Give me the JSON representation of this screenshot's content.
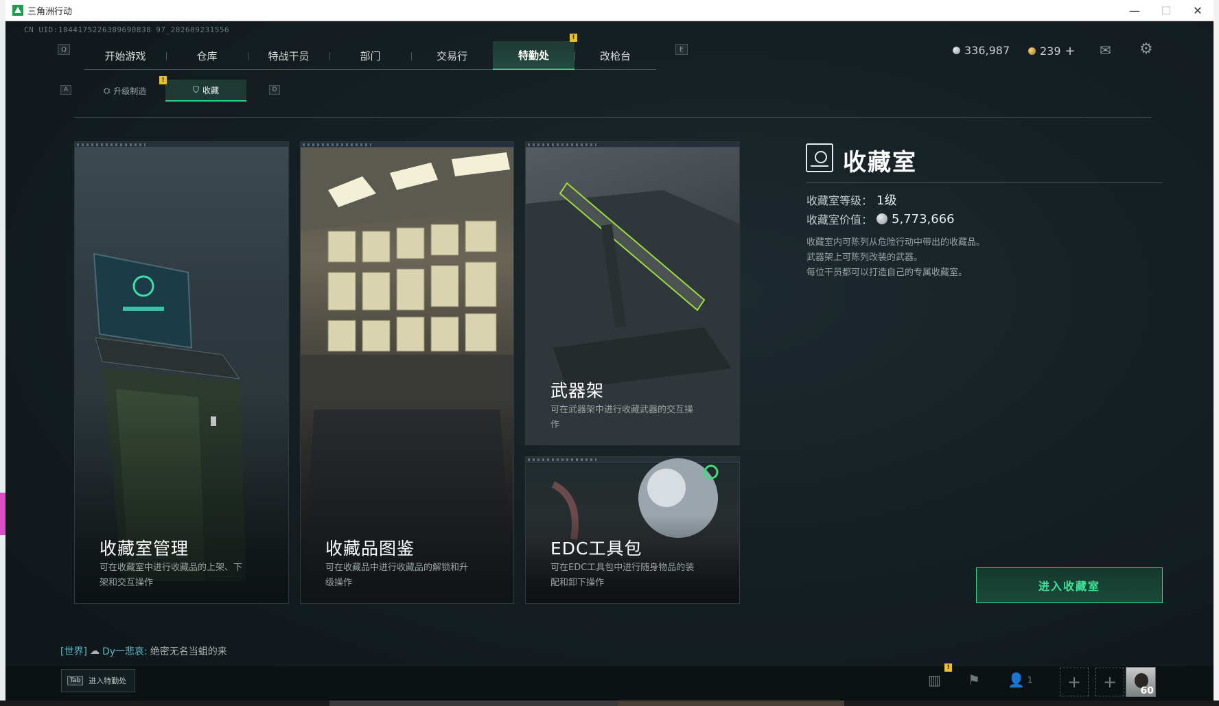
{
  "window": {
    "title": "三角洲行动"
  },
  "uid_text": "CN UID:1844175226389690838 97_202609231556",
  "nav": {
    "left_key": "Q",
    "right_key": "E",
    "tabs": [
      "开始游戏",
      "仓库",
      "特战干员",
      "部门",
      "交易行",
      "特勤处",
      "改枪台"
    ],
    "active_index": 5,
    "badge": "!"
  },
  "currency": {
    "silver": "336,987",
    "gold": "239",
    "plus": "+"
  },
  "subnav": {
    "left_key": "A",
    "right_key": "D",
    "items": [
      "升级制造",
      "收藏"
    ],
    "active_index": 1,
    "badge": "!"
  },
  "cards": [
    {
      "title": "收藏室管理",
      "desc": [
        "可在收藏室中进行收藏品的上架、下",
        "架和交互操作"
      ]
    },
    {
      "title": "收藏品图鉴",
      "desc": [
        "可在收藏品中进行收藏品的解锁和升",
        "级操作"
      ]
    },
    {
      "title": "武器架",
      "desc": [
        "可在武器架中进行收藏武器的交互操",
        "作"
      ]
    },
    {
      "title": "EDC工具包",
      "desc": [
        "可在EDC工具包中进行随身物品的装",
        "配和卸下操作"
      ]
    }
  ],
  "info": {
    "title": "收藏室",
    "level_label": "收藏室等级：",
    "level_value": "1级",
    "value_label": "收藏室价值：",
    "value_amount": "5,773,666",
    "desc": [
      "收藏室内可陈列从危险行动中带出的收藏品。",
      "武器架上可陈列改装的武器。",
      "每位干员都可以打造自己的专属收藏室。"
    ],
    "enter_button": "进入收藏室"
  },
  "chat": {
    "channel": "[世界]",
    "name": "Dy一悲哀:",
    "message": "绝密无名当蛆的来"
  },
  "bottom": {
    "tab_key": "Tab",
    "tab_label": "进入特勤处",
    "friends_count": "1",
    "level": "60",
    "badge": "!"
  },
  "colors": {
    "accent": "#2fd18a",
    "badge": "#e8c12a",
    "background": "#141d21"
  }
}
